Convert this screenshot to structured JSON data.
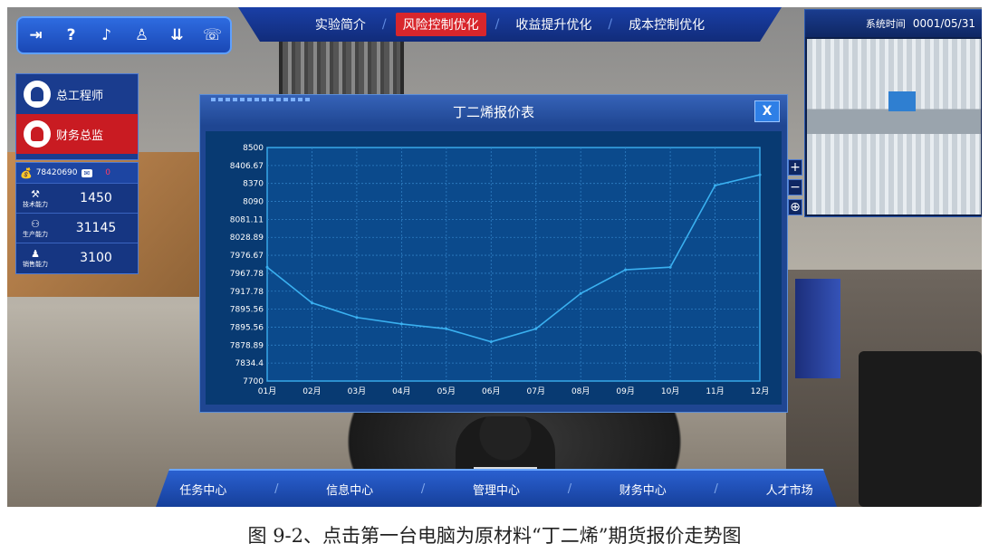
{
  "toolbar": {
    "icons": [
      "exit-icon",
      "help-icon",
      "music-icon",
      "user-icon",
      "download-icon",
      "phone-icon"
    ],
    "glyphs": [
      "⇥",
      "?",
      "♪",
      "♙",
      "⇊",
      "☏"
    ]
  },
  "topnav": {
    "items": [
      "实验简介",
      "风险控制优化",
      "收益提升优化",
      "成本控制优化"
    ],
    "active_index": 1,
    "separator": "/"
  },
  "minimap": {
    "time_label": "系统时间",
    "time_value": "0001/05/31",
    "controls": [
      "+",
      "−",
      "⊕"
    ]
  },
  "roles": [
    {
      "label": "总工程师",
      "active": false
    },
    {
      "label": "财务总监",
      "active": true
    }
  ],
  "stats": {
    "money": "78420690",
    "badge": "0",
    "rows": [
      {
        "label": "技术能力",
        "value": "1450"
      },
      {
        "label": "生产能力",
        "value": "31145"
      },
      {
        "label": "销售能力",
        "value": "3100"
      }
    ]
  },
  "window": {
    "title": "丁二烯报价表",
    "close_label": "X"
  },
  "chart_data": {
    "type": "line",
    "title": "丁二烯报价表",
    "categories": [
      "01月",
      "02月",
      "03月",
      "04月",
      "05月",
      "06月",
      "07月",
      "08月",
      "09月",
      "10月",
      "11月",
      "12月"
    ],
    "values": [
      8090,
      7967.78,
      7917.78,
      7895.56,
      7878.89,
      7834.4,
      7878.89,
      8000,
      8081.11,
      8090,
      8370,
      8406.67
    ],
    "y_ticks": [
      "8500",
      "8406.67",
      "8370",
      "8090",
      "8081.11",
      "8028.89",
      "7976.67",
      "7967.78",
      "7917.78",
      "7895.56",
      "7895.56",
      "7878.89",
      "7834.4",
      "7700"
    ],
    "ylim": [
      7700,
      8500
    ],
    "grid": true,
    "line_color": "#3ab0f0"
  },
  "bottomnav": {
    "items": [
      "任务中心",
      "信息中心",
      "管理中心",
      "财务中心",
      "人才市场"
    ],
    "separator": "/"
  },
  "caption": "图 9-2、点击第一台电脑为原材料“丁二烯”期货报价走势图"
}
